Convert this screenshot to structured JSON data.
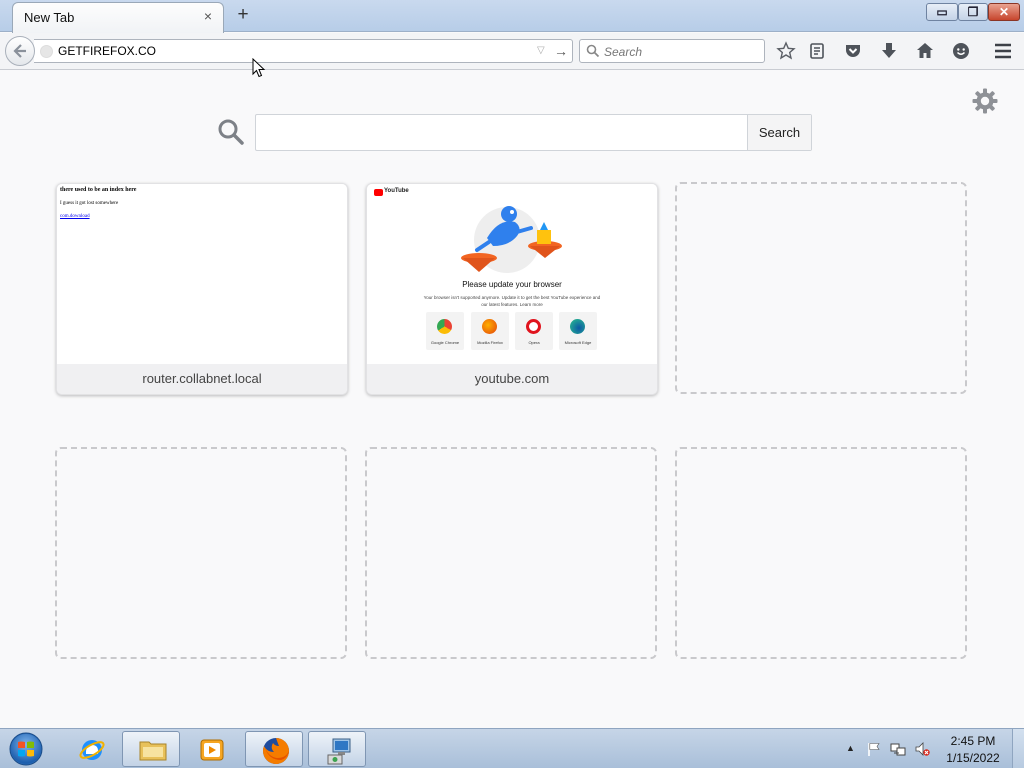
{
  "browser": {
    "tab": {
      "title": "New Tab",
      "close_glyph": "×"
    },
    "new_tab_glyph": "+",
    "window_controls": {
      "minimize": "▭",
      "maximize": "❐",
      "close": "✕"
    },
    "url_bar": {
      "value": "GETFIREFOX.CO",
      "dropdown_glyph": "▽",
      "go_glyph": "→"
    },
    "search_bar": {
      "placeholder": "Search"
    },
    "toolbar_icons": [
      "bookmark-star-icon",
      "reading-list-icon",
      "pocket-icon",
      "downloads-icon",
      "home-icon",
      "hello-chat-icon",
      "hamburger-menu-icon"
    ]
  },
  "new_tab_page": {
    "search": {
      "placeholder": "",
      "button_label": "Search"
    },
    "settings_icon": "gear-icon",
    "tiles": [
      {
        "label": "router.collabnet.local",
        "thumbnail": {
          "line1": "there used to be an index here",
          "line2": "I guess it got lost somewhere",
          "link": "com.download"
        }
      },
      {
        "label": "youtube.com",
        "thumbnail": {
          "logo_text": "YouTube",
          "heading": "Please update your browser",
          "body": "Your browser isn't supported anymore. Update it to get the best YouTube experience and our latest features. Learn more",
          "browsers": [
            "Google Chrome",
            "Mozilla Firefox",
            "Opera",
            "Microsoft Edge"
          ]
        }
      },
      {
        "label": ""
      },
      {
        "label": ""
      },
      {
        "label": ""
      },
      {
        "label": ""
      }
    ]
  },
  "taskbar": {
    "items": [
      "start-orb",
      "internet-explorer",
      "windows-explorer",
      "media-player",
      "firefox",
      "network-setup"
    ],
    "clock": {
      "time": "2:45 PM",
      "date": "1/15/2022"
    },
    "tray_up_glyph": "▲"
  },
  "colors": {
    "accent_blue": "#0a84ff",
    "tab_strip": "#c9d9ee",
    "taskbar": "#b7cae0",
    "close_red": "#c7452d"
  }
}
